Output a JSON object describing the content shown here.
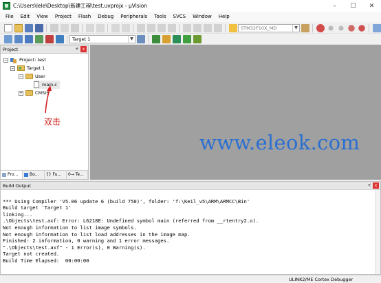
{
  "window": {
    "title": "C:\\Users\\lele\\Desktop\\新建工程\\test.uvprojx - µVision",
    "minimize": "–",
    "maximize": "☐",
    "close": "✕"
  },
  "menu": [
    "File",
    "Edit",
    "View",
    "Project",
    "Flash",
    "Debug",
    "Peripherals",
    "Tools",
    "SVCS",
    "Window",
    "Help"
  ],
  "toolbar": {
    "device_select": "STM32F10X_MD",
    "target_select": "Target 1"
  },
  "project_panel": {
    "title": "Project",
    "pin": "ᗕ",
    "close": "x",
    "tree": {
      "root": "Project: test",
      "target": "Target 1",
      "group_user": "User",
      "file_main": "main.c",
      "group_cmsis": "CMSIS"
    },
    "tabs": [
      "Pro...",
      "Bo...",
      "{} Fu...",
      "0→ Te..."
    ]
  },
  "annotation": "双击",
  "watermark": "www.eleok.com",
  "build_output": {
    "title": "Build Output",
    "lines": [
      "*** Using Compiler 'V5.06 update 6 (build 750)', folder: 'f:\\Keil_v5\\ARM\\ARMCC\\Bin'",
      "Build target 'Target 1'",
      "linking...",
      ".\\Objects\\test.axf: Error: L6218E: Undefined symbol main (referred from __rtentry2.o).",
      "Not enough information to list image symbols.",
      "Not enough information to list load addresses in the image map.",
      "Finished: 2 information, 0 warning and 1 error messages.",
      "\".\\Objects\\test.axf\" - 1 Error(s), 0 Warning(s).",
      "Target not created.",
      "Build Time Elapsed:  00:00:00"
    ]
  },
  "status": {
    "debugger": "ULINK2/ME Cortex Debugger"
  },
  "colors": {
    "watermark": "#2a6fd1",
    "annotation": "#d21f1f",
    "editor_bg": "#a0a0a0"
  }
}
